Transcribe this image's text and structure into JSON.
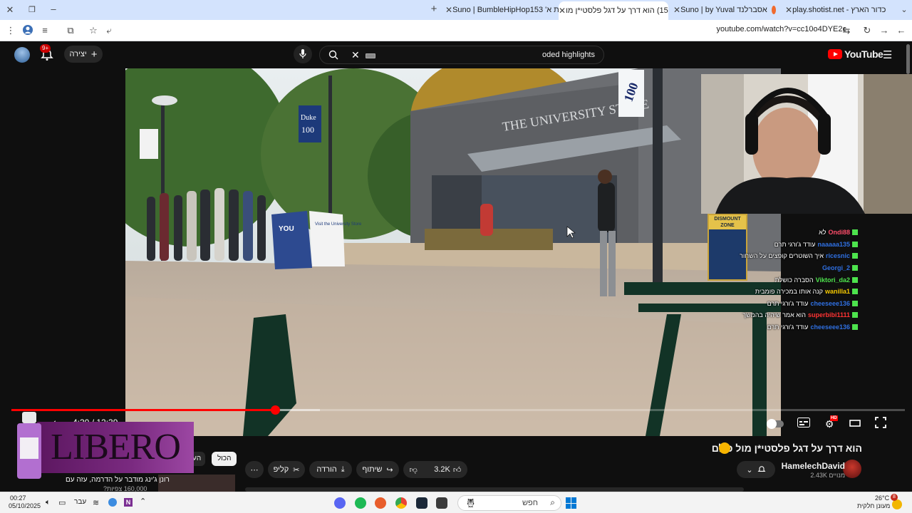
{
  "browser": {
    "tabs": [
      {
        "title": "כדור הארץ - play.shotist.net",
        "icon": "globe-icon",
        "color": "#4caf50"
      },
      {
        "title": "אסברלנד Suno | by Yuval",
        "icon": "suno-icon",
        "color": "#f06a2e"
      },
      {
        "title": "(15) הוא דרך על דגל פלסטי*ן מו",
        "icon": "youtube-icon",
        "color": "#ff0000",
        "active": true
      },
      {
        "title": "בית א' Suno | BumbleHipHop153",
        "icon": "suno-icon",
        "color": "#f06a2e"
      }
    ],
    "url": "youtube.com/watch?v=cc10o4DYE2c"
  },
  "youtube": {
    "search_query": "oded highlights",
    "create_label": "יצירה",
    "notification_count": "9+",
    "logo_text": "YouTube"
  },
  "video": {
    "time_display": "4:30 / 12:39",
    "progress": 0.295,
    "buffered": 0.345,
    "quality_badge": "HD"
  },
  "scene_text": {
    "banner1": "Duke",
    "banner1_num": "100",
    "sign_right": "Visit the University Store",
    "sign_left": "YOU",
    "dismount": "DISMOUNT ZONE",
    "store_name": "THE UNIVERSITY STORE"
  },
  "chat": [
    {
      "user": "Ondi88",
      "msg": "לא",
      "color": "#ff4d6a"
    },
    {
      "user": "naaaaa135",
      "msg": "עודד ג'ורגי תרם",
      "color": "#2f6fe0"
    },
    {
      "user": "ricesnic",
      "msg": "איך השוטרים קופצים על השחור",
      "color": "#2f6fe0"
    },
    {
      "user": "Georgi_2",
      "msg": "",
      "color": "#2f6fe0"
    },
    {
      "user": "Viktori_da2",
      "msg": "הסברה כושלת",
      "color": "#4de34d"
    },
    {
      "user": "wanilla1",
      "msg": "קנה אותו במכירה פומבית",
      "color": "#f4c800"
    },
    {
      "user": "cheeseee136",
      "msg": "עודד ג'ורגי תרם",
      "color": "#2f6fe0"
    },
    {
      "user": "superbibi1111",
      "msg": "הוא אמר שיהיה בהמשך",
      "color": "#ff3333"
    },
    {
      "user": "cheeseee136",
      "msg": "עודד ג'ורגי תרם",
      "color": "#2f6fe0"
    }
  ],
  "details": {
    "title": "הוא דרך על דגל פלסטי*ן מול כולם",
    "channel": "HamelechDavid",
    "subscribers": "2.43K מנויים",
    "likes": "3.2K",
    "share_label": "שיתוף",
    "download_label": "הורדה",
    "clip_label": "קליפ",
    "chip_all": "הכול",
    "chip_partial": "הע"
  },
  "overlay": {
    "brand": "LIBERO",
    "rec_title": "רונן ג'ינג מודבר על הדרמה, עזה עם",
    "rec_views": "160,000 צפיות?"
  },
  "taskbar": {
    "time": "00:27",
    "date": "05/10/2025",
    "lang": "עבר",
    "search_placeholder": "חפש",
    "temp": "26°C",
    "weather": "מעונן חלקית",
    "notif_count": "8"
  }
}
